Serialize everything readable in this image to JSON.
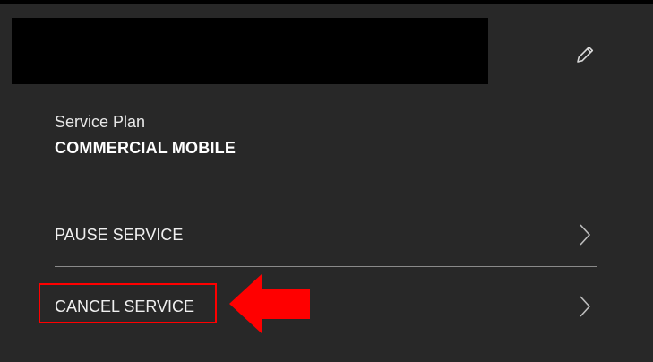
{
  "service_plan": {
    "label": "Service Plan",
    "value": "COMMERCIAL MOBILE"
  },
  "actions": {
    "pause_label": "PAUSE SERVICE",
    "cancel_label": "CANCEL SERVICE"
  },
  "icons": {
    "edit": "pencil-icon",
    "chevron": "chevron-right-icon"
  },
  "colors": {
    "background": "#282828",
    "text": "#ffffff",
    "divider": "#8a8a8a",
    "annotation": "#ff0000"
  }
}
